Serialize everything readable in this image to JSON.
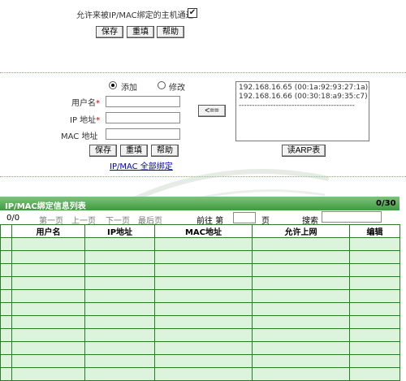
{
  "top": {
    "allow_label": "允许来被IP/MAC绑定的主机通过",
    "allow_checked": true,
    "save": "保存",
    "reset": "重填",
    "help": "帮助"
  },
  "form": {
    "radio_add": "添加",
    "radio_edit": "修改",
    "username_label": "用户名",
    "ip_label": "IP 地址",
    "mac_label": "MAC 地址",
    "required_mark": "*",
    "save": "保存",
    "reset": "重填",
    "help": "帮助",
    "bind_all_link": "IP/MAC 全部绑定",
    "arrow_button": "<==",
    "arp_list": [
      "192.168.16.65  (00:1a:92:93:27:1a)",
      "192.168.16.66  (00:30:18:a9:35:c7)",
      "--------------------------------------------"
    ],
    "read_arp": "读ARP表"
  },
  "table_section": {
    "title": "IP/MAC绑定信息列表",
    "count": "0/30",
    "page_info": "0/0",
    "first": "第一页",
    "prev": "上一页",
    "next": "下一页",
    "last": "最后页",
    "goto_label": "前往 第",
    "page_unit": "页",
    "search_label": "搜索",
    "columns": [
      "",
      "用户名",
      "IP地址",
      "MAC地址",
      "允许上网",
      "编辑"
    ],
    "empty_rows": 11
  },
  "colors": {
    "green_bar": "#4fa54f",
    "row_fill": "#dcf3dc",
    "grid_line": "#2d7a2d"
  }
}
